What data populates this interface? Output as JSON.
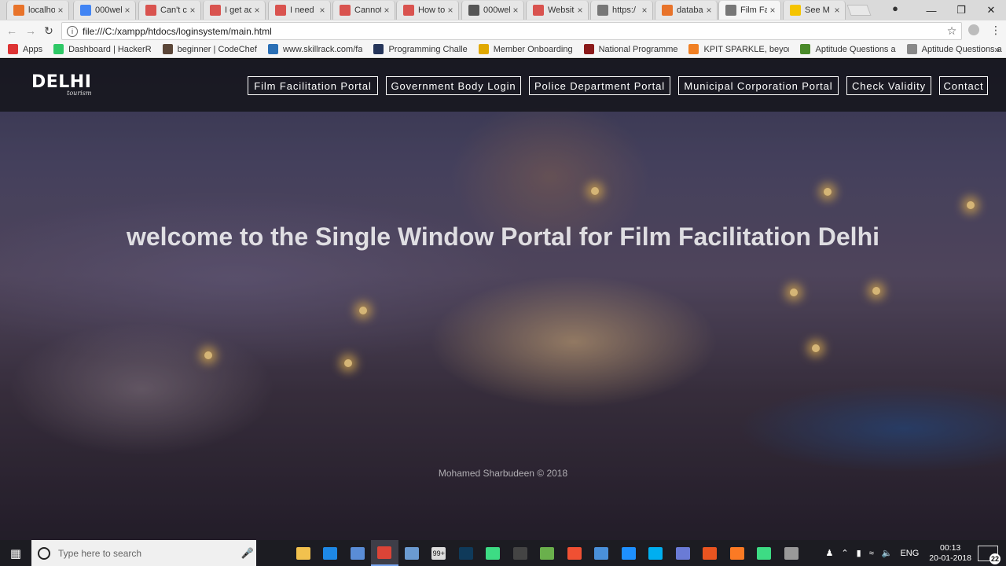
{
  "browser": {
    "tabs": [
      {
        "label": "localho",
        "icon": "xampp-icon",
        "color": "#e8732a"
      },
      {
        "label": "000wel",
        "icon": "google-icon",
        "color": "#4285f4"
      },
      {
        "label": "Can't c",
        "icon": "stackoverflow-icon",
        "color": "#d9534f"
      },
      {
        "label": "I get ac",
        "icon": "stackoverflow-icon",
        "color": "#d9534f"
      },
      {
        "label": "I need",
        "icon": "stackoverflow-icon",
        "color": "#d9534f"
      },
      {
        "label": "Cannot",
        "icon": "stackoverflow-icon",
        "color": "#d9534f"
      },
      {
        "label": "How to",
        "icon": "stackoverflow-icon",
        "color": "#d9534f"
      },
      {
        "label": "000wel",
        "icon": "octocat-icon",
        "color": "#555555"
      },
      {
        "label": "Websit",
        "icon": "stackoverflow-icon",
        "color": "#d9534f"
      },
      {
        "label": "https:/",
        "icon": "page-icon",
        "color": "#777777"
      },
      {
        "label": "databa",
        "icon": "xampp-icon",
        "color": "#e8732a"
      },
      {
        "label": "Film Fa",
        "icon": "page-icon",
        "color": "#777777",
        "active": true
      },
      {
        "label": "See M",
        "icon": "lightning-icon",
        "color": "#f5c400"
      }
    ],
    "url": "file:///C:/xampp/htdocs/loginsystem/main.html",
    "bookmarks": [
      {
        "label": "Apps",
        "color": "#d33"
      },
      {
        "label": "Dashboard | HackerR",
        "color": "#2ec866"
      },
      {
        "label": "beginner | CodeChef",
        "color": "#5b4638"
      },
      {
        "label": "www.skillrack.com/fa",
        "color": "#2a6fb5"
      },
      {
        "label": "Programming Challe",
        "color": "#25355a"
      },
      {
        "label": "Member Onboarding",
        "color": "#e0a800"
      },
      {
        "label": "National Programme",
        "color": "#8b1a1a"
      },
      {
        "label": "KPIT SPARKLE, beyon",
        "color": "#f07f22"
      },
      {
        "label": "Aptitude Questions a",
        "color": "#4a8a2a"
      },
      {
        "label": "Aptitude Questions a",
        "color": "#888888"
      }
    ]
  },
  "site": {
    "brand": "DELHI",
    "brand_sub": "tourism",
    "nav": [
      {
        "label": "Film Facilitation Portal"
      },
      {
        "label": "Government Body Login"
      },
      {
        "label": "Police Department Portal"
      },
      {
        "label": "Municipal Corporation Portal"
      },
      {
        "label": "Check Validity"
      },
      {
        "label": "Contact"
      }
    ],
    "hero_title": "welcome to the Single Window Portal for Film Facilitation Delhi",
    "footer": "Mohamed Sharbudeen © 2018"
  },
  "taskbar": {
    "search_placeholder": "Type here to search",
    "language": "ENG",
    "time": "00:13",
    "date": "20-01-2018",
    "notifications": "22",
    "badge": "99+",
    "apps": [
      {
        "name": "task-view-icon",
        "color": "#1c1c22"
      },
      {
        "name": "file-explorer-icon",
        "color": "#f2c14e"
      },
      {
        "name": "edge-icon",
        "color": "#1e88e5"
      },
      {
        "name": "store-icon",
        "color": "#5a8dd6"
      },
      {
        "name": "chrome-icon",
        "color": "#db4437",
        "active": true
      },
      {
        "name": "virtualbox-icon",
        "color": "#6b9bd1"
      },
      {
        "name": "learning-icon",
        "color": "#dddddd"
      },
      {
        "name": "photoshop-icon",
        "color": "#0f3a5a"
      },
      {
        "name": "android-icon",
        "color": "#3ddc84"
      },
      {
        "name": "terminal-icon",
        "color": "#444444"
      },
      {
        "name": "android-studio-icon",
        "color": "#6ab04c"
      },
      {
        "name": "git-icon",
        "color": "#f05033"
      },
      {
        "name": "paint-icon",
        "color": "#4a90d9"
      },
      {
        "name": "sync-icon",
        "color": "#1e90ff"
      },
      {
        "name": "skype-icon",
        "color": "#00aff0"
      },
      {
        "name": "media-icon",
        "color": "#6a7bd6"
      },
      {
        "name": "ubuntu-icon",
        "color": "#e95420"
      },
      {
        "name": "xampp-icon",
        "color": "#fb7a24"
      },
      {
        "name": "android-sdk-icon",
        "color": "#3ddc84"
      },
      {
        "name": "tools-icon",
        "color": "#999999"
      }
    ]
  }
}
